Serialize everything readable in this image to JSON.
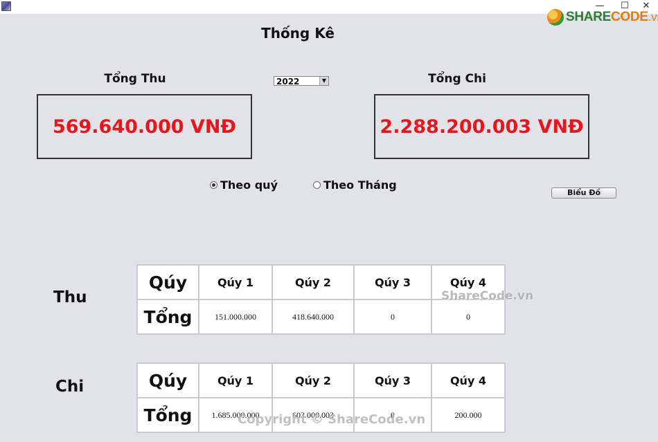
{
  "window": {
    "minimize_glyph": "—",
    "maximize_glyph": "☐",
    "close_glyph": "✕"
  },
  "logo": {
    "part1": "SHARE",
    "part2": "CODE",
    "tld": ".vn"
  },
  "title": "Thống Kê",
  "totals": {
    "thu_label": "Tổng Thu",
    "thu_value": "569.640.000 VNĐ",
    "chi_label": "Tổng Chi",
    "chi_value": "2.288.200.003 VNĐ"
  },
  "year_select": {
    "value": "2022",
    "arrow": "▼"
  },
  "view_mode": {
    "option_quarter": "Theo quý",
    "option_month": "Theo Tháng",
    "selected": "quarter"
  },
  "chart_button": "Biểu Đồ",
  "thu_table": {
    "section_label": "Thu",
    "row_header_top": "Qúy",
    "row_header_bottom": "Tổng",
    "columns": [
      "Qúy 1",
      "Qúy 2",
      "Qúy 3",
      "Qúy 4"
    ],
    "values": [
      "151.000.000",
      "418.640.000",
      "0",
      "0"
    ]
  },
  "chi_table": {
    "section_label": "Chi",
    "row_header_top": "Qúy",
    "row_header_bottom": "Tổng",
    "columns": [
      "Qúy 1",
      "Qúy 2",
      "Qúy 3",
      "Qúy 4"
    ],
    "values": [
      "1.685.000.000",
      "603.000.003",
      "0",
      "200.000"
    ]
  },
  "watermarks": {
    "middle": "ShareCode.vn",
    "bottom": "Copyright © ShareCode.vn"
  },
  "colors": {
    "total_red": "#e8161a",
    "background": "#e2e3e9"
  }
}
